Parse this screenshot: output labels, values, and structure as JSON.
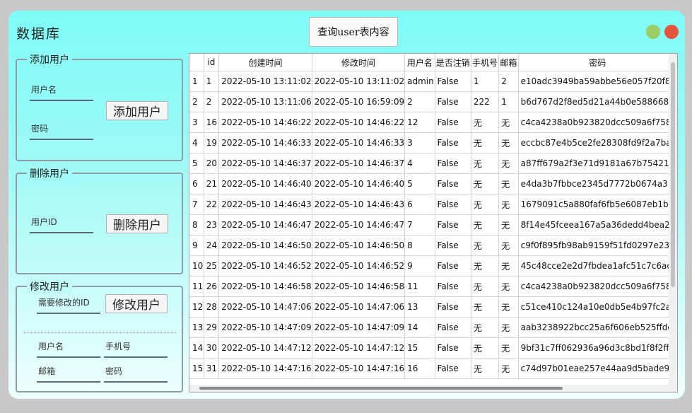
{
  "app": {
    "title": "数据库",
    "query_button": "查询user表内容"
  },
  "add_group": {
    "title": "添加用户",
    "username_placeholder": "用户名",
    "password_placeholder": "密码",
    "button": "添加用户"
  },
  "delete_group": {
    "title": "删除用户",
    "userid_placeholder": "用户ID",
    "button": "删除用户"
  },
  "modify_group": {
    "title": "修改用户",
    "target_id_placeholder": "需要修改的ID",
    "button": "修改用户",
    "username_placeholder": "用户名",
    "phone_placeholder": "手机号",
    "email_placeholder": "邮箱",
    "password_placeholder": "密码"
  },
  "table": {
    "columns": [
      "",
      "id",
      "创建时间",
      "修改时间",
      "用户名",
      "是否注销",
      "手机号",
      "邮箱",
      "密码"
    ],
    "rows": [
      [
        "1",
        "1",
        "2022-05-10 13:11:02",
        "2022-05-10 13:11:02",
        "admin",
        "False",
        "1",
        "2",
        "e10adc3949ba59abbe56e057f20f8"
      ],
      [
        "2",
        "2",
        "2022-05-10 13:11:06",
        "2022-05-10 16:59:09",
        "2",
        "False",
        "222",
        "1",
        "b6d767d2f8ed5d21a44b0e588668"
      ],
      [
        "3",
        "16",
        "2022-05-10 14:46:22",
        "2022-05-10 14:46:22",
        "12",
        "False",
        "无",
        "无",
        "c4ca4238a0b923820dcc509a6f758"
      ],
      [
        "4",
        "19",
        "2022-05-10 14:46:33",
        "2022-05-10 14:46:33",
        "3",
        "False",
        "无",
        "无",
        "eccbc87e4b5ce2fe28308fd9f2a7ba"
      ],
      [
        "5",
        "20",
        "2022-05-10 14:46:37",
        "2022-05-10 14:46:37",
        "4",
        "False",
        "无",
        "无",
        "a87ff679a2f3e71d9181a67b754212"
      ],
      [
        "6",
        "21",
        "2022-05-10 14:46:40",
        "2022-05-10 14:46:40",
        "5",
        "False",
        "无",
        "无",
        "e4da3b7fbbce2345d7772b0674a3"
      ],
      [
        "7",
        "22",
        "2022-05-10 14:46:43",
        "2022-05-10 14:46:43",
        "6",
        "False",
        "无",
        "无",
        "1679091c5a880faf6fb5e6087eb1b2"
      ],
      [
        "8",
        "23",
        "2022-05-10 14:46:47",
        "2022-05-10 14:46:47",
        "7",
        "False",
        "无",
        "无",
        "8f14e45fceea167a5a36dedd4bea2"
      ],
      [
        "9",
        "24",
        "2022-05-10 14:46:50",
        "2022-05-10 14:46:50",
        "8",
        "False",
        "无",
        "无",
        "c9f0f895fb98ab9159f51fd0297e23"
      ],
      [
        "10",
        "25",
        "2022-05-10 14:46:52",
        "2022-05-10 14:46:52",
        "9",
        "False",
        "无",
        "无",
        "45c48cce2e2d7fbdea1afc51c7c6ac"
      ],
      [
        "11",
        "26",
        "2022-05-10 14:46:58",
        "2022-05-10 14:46:58",
        "11",
        "False",
        "无",
        "无",
        "c4ca4238a0b923820dcc509a6f758"
      ],
      [
        "12",
        "28",
        "2022-05-10 14:47:06",
        "2022-05-10 14:47:06",
        "13",
        "False",
        "无",
        "无",
        "c51ce410c124a10e0db5e4b97fc2a"
      ],
      [
        "13",
        "29",
        "2022-05-10 14:47:09",
        "2022-05-10 14:47:09",
        "14",
        "False",
        "无",
        "无",
        "aab3238922bcc25a6f606eb525ffdc"
      ],
      [
        "14",
        "30",
        "2022-05-10 14:47:12",
        "2022-05-10 14:47:12",
        "15",
        "False",
        "无",
        "无",
        "9bf31c7ff062936a96d3c8bd1f8f2ff"
      ],
      [
        "15",
        "31",
        "2022-05-10 14:47:16",
        "2022-05-10 14:47:16",
        "16",
        "False",
        "无",
        "无",
        "c74d97b01eae257e44aa9d5bade9"
      ]
    ]
  }
}
